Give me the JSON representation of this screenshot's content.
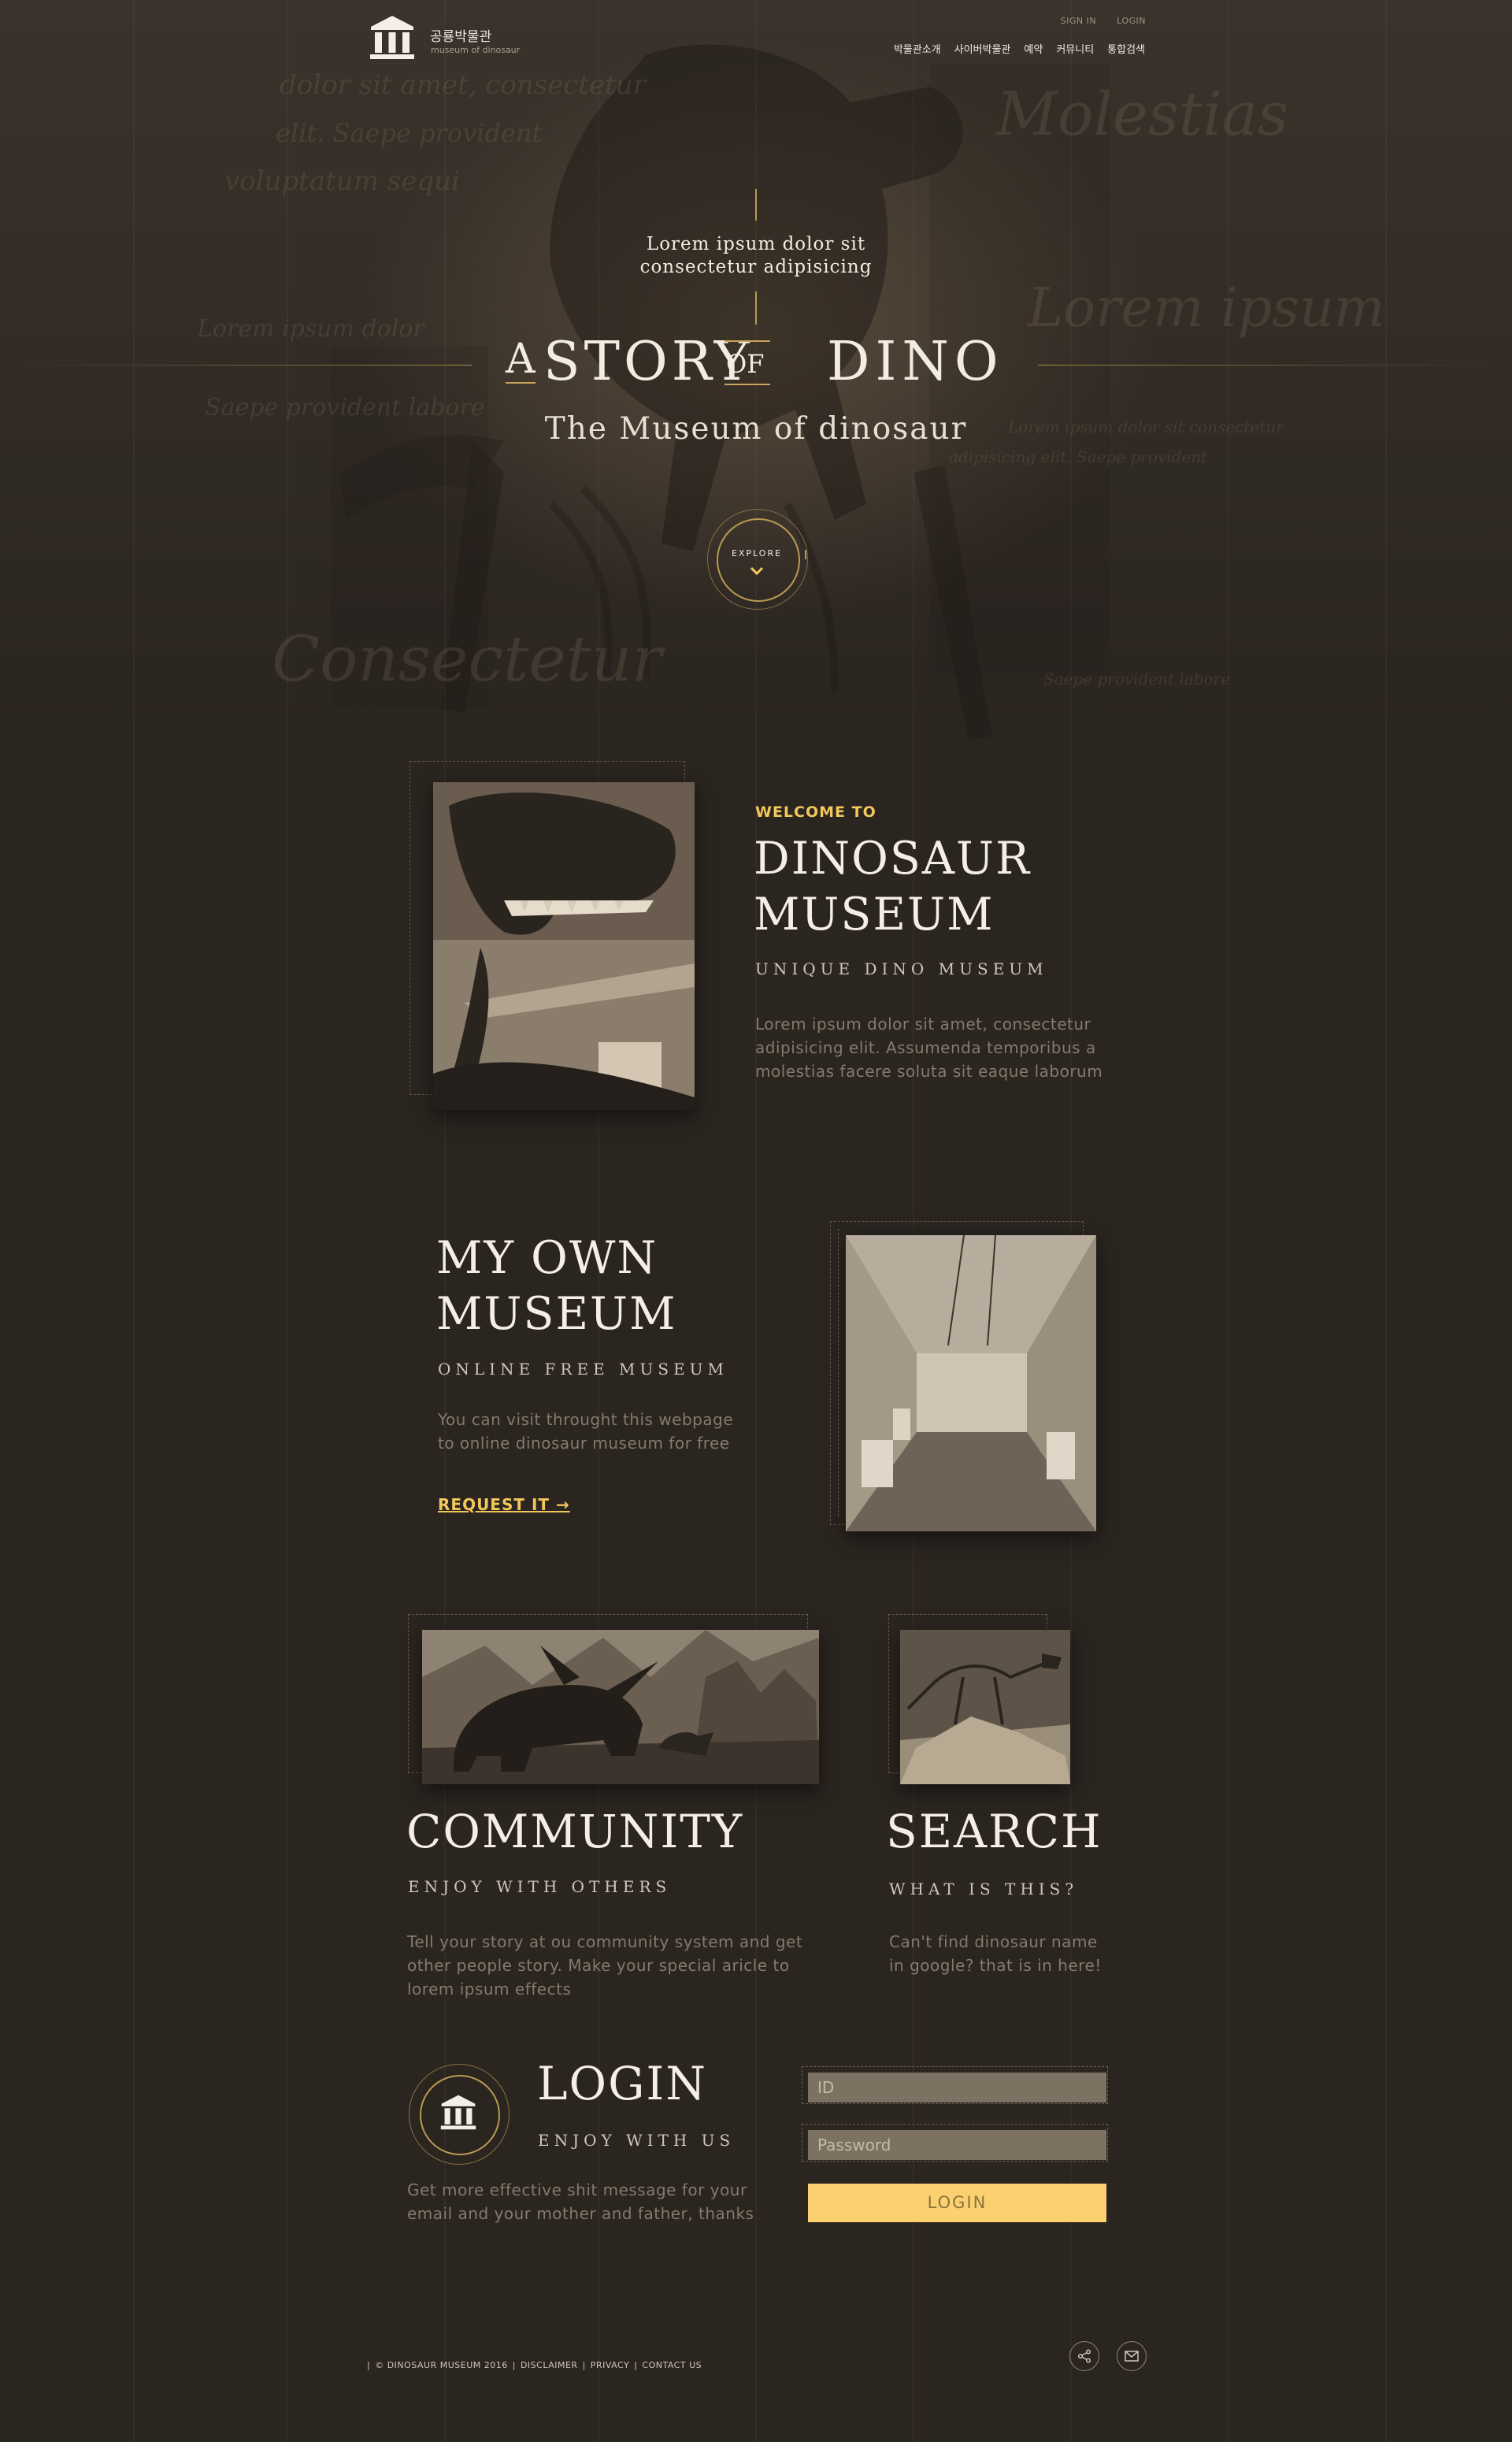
{
  "header": {
    "logo_title": "공룡박물관",
    "logo_sub": "museum of dinosaur",
    "top_links": [
      "SIGN IN",
      "LOGIN"
    ],
    "nav": [
      "박물관소개",
      "사이버박물관",
      "예약",
      "커뮤니티",
      "통합검색"
    ]
  },
  "hero": {
    "lead_line1": "Lorem ipsum dolor sit",
    "lead_line2": "consectetur adipisicing",
    "title_a": "A",
    "title_story": "STORY",
    "title_of": "OF",
    "title_dino": "DINO",
    "subtitle": "The Museum of dinosaur",
    "explore_label": "EXPLORE",
    "script_texts": [
      "dolor sit amet, consectetur",
      "elit. Saepe provident",
      "voluptatum sequi",
      "Lorem ipsum dolor",
      "Saepe provident labore",
      "Consectetur",
      "Lorem ipsum",
      "Lorem ipsum dolor sit consectetur",
      "adipisicing elit. Saepe provident",
      "Saepe provident labore",
      "Molestias"
    ]
  },
  "welcome": {
    "eyebrow": "WELCOME TO",
    "title_line1": "DINOSAUR",
    "title_line2": "MUSEUM",
    "subtitle": "UNIQUE DINO MUSEUM",
    "body_line1": "Lorem ipsum dolor sit amet, consectetur",
    "body_line2": "adipisicing elit. Assumenda temporibus a",
    "body_line3": "molestias facere soluta sit eaque laborum"
  },
  "my_museum": {
    "title_line1": "MY OWN",
    "title_line2": "MUSEUM",
    "subtitle": "ONLINE FREE MUSEUM",
    "body_line1": "You can visit throught this webpage",
    "body_line2": "to online dinosaur museum for free",
    "link": "REQUEST IT →"
  },
  "community": {
    "title": "COMMUNITY",
    "subtitle": "ENJOY WITH OTHERS",
    "body_line1": "Tell your story at ou community system and get",
    "body_line2": "other people story. Make your special aricle to",
    "body_line3": "lorem ipsum effects"
  },
  "search": {
    "title": "SEARCH",
    "subtitle": "WHAT IS THIS?",
    "body_line1": "Can't find dinosaur name",
    "body_line2": "in google? that is in here!"
  },
  "login": {
    "title": "LOGIN",
    "subtitle": "ENJOY WITH US",
    "body_line1": "Get more effective shit message for your",
    "body_line2": "email and your mother and father, thanks",
    "id_placeholder": "ID",
    "password_placeholder": "Password",
    "button": "LOGIN"
  },
  "footer": {
    "bar": "|",
    "copyright": "© DINOSAUR MUSEUM 2016",
    "sep": "|",
    "links": [
      "DISCLAIMER",
      "PRIVACY",
      "CONTACT US"
    ]
  },
  "colors": {
    "background": "#2b2520",
    "accent_gold": "#f2c75c",
    "button_gold": "#fbd06e",
    "line_gold": "#b99a52",
    "field": "#7d7162"
  },
  "icons": [
    "museum-icon",
    "chevron-down-icon",
    "share-icon",
    "mail-icon"
  ]
}
